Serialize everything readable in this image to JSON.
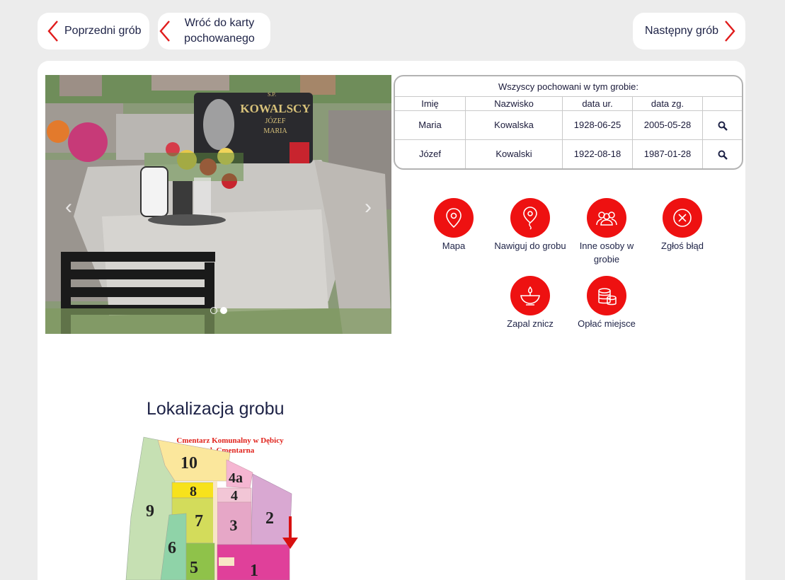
{
  "nav": {
    "prev_label": "Poprzedni grób",
    "back_label": "Wróć do karty pochowanego",
    "next_label": "Następny grób"
  },
  "table": {
    "caption": "Wszyscy pochowani w tym grobie:",
    "headers": [
      "Imię",
      "Nazwisko",
      "data ur.",
      "data zg."
    ],
    "rows": [
      {
        "first": "Maria",
        "last": "Kowalska",
        "born": "1928-06-25",
        "died": "2005-05-28"
      },
      {
        "first": "Józef",
        "last": "Kowalski",
        "born": "1922-08-18",
        "died": "1987-01-28"
      }
    ]
  },
  "actions": [
    {
      "label": "Mapa",
      "icon": "map-pin-icon"
    },
    {
      "label": "Nawiguj do grobu",
      "icon": "navigate-pin-icon"
    },
    {
      "label": "Inne osoby w grobie",
      "icon": "people-icon"
    },
    {
      "label": "Zgłoś błąd",
      "icon": "close-circle-icon"
    },
    {
      "label": "Zapal znicz",
      "icon": "candle-icon"
    },
    {
      "label": "Opłać miejsce",
      "icon": "coins-icon"
    }
  ],
  "photo": {
    "headstone_top": "S.P.",
    "headstone_family": "KOWALSCY",
    "headstone_name1": "JÓZEF",
    "headstone_name2": "MARIA"
  },
  "location": {
    "title": "Lokalizacja grobu",
    "map_title_line1": "Cmentarz Komunalny w Dębicy",
    "map_title_line2": "ul. Cmentarna",
    "sections": [
      "10",
      "4a",
      "8",
      "4",
      "9",
      "7",
      "3",
      "2",
      "6",
      "5",
      "1"
    ]
  },
  "colors": {
    "accent": "#ee1111",
    "text": "#1d2246"
  }
}
